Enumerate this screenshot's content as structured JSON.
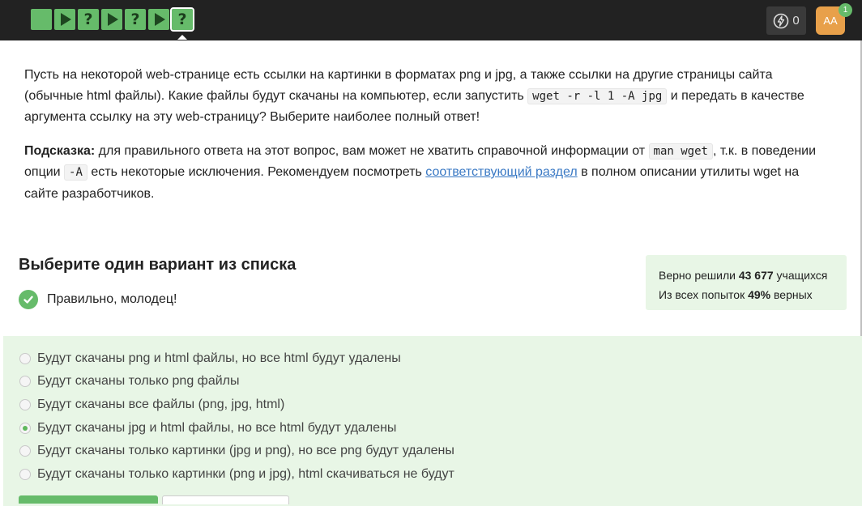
{
  "topbar": {
    "steps": [
      {
        "type": "solved"
      },
      {
        "type": "play"
      },
      {
        "type": "question",
        "label": "?"
      },
      {
        "type": "play"
      },
      {
        "type": "question",
        "label": "?"
      },
      {
        "type": "play"
      },
      {
        "type": "question",
        "label": "?",
        "active": true
      }
    ],
    "energy_count": "0",
    "avatar_initials": "AA",
    "notification_count": "1"
  },
  "question": {
    "p1_a": "Пусть на некоторой web-странице есть ссылки на картинки в форматах png и jpg, а также ссылки на другие страницы сайта (обычные html файлы). Какие файлы будут скачаны на компьютер, если запустить ",
    "p1_code": "wget -r -l 1 -A jpg",
    "p1_b": " и передать в качестве аргумента ссылку на эту web-страницу? Выберите наиболее полный ответ!",
    "hint_label": "Подсказка:",
    "hint_a": " для правильного ответа на этот вопрос, вам может не хватить справочной информации от ",
    "hint_code1": "man wget",
    "hint_b": ", т.к. в поведении опции ",
    "hint_code2": "-A",
    "hint_c": " есть некоторые исключения. Рекомендуем посмотреть ",
    "hint_link": "соответствующий раздел",
    "hint_d": " в полном описании утилиты wget на сайте разработчиков."
  },
  "choose_title": "Выберите один вариант из списка",
  "feedback": "Правильно, молодец!",
  "stats": {
    "line1_prefix": "Верно решили ",
    "line1_value": "43 677",
    "line1_suffix": " учащихся",
    "line2_prefix": "Из всех попыток ",
    "line2_value": "49%",
    "line2_suffix": " верных"
  },
  "options": [
    {
      "label": "Будут скачаны png и html файлы, но все html будут удалены",
      "selected": false
    },
    {
      "label": "Будут скачаны только png файлы",
      "selected": false
    },
    {
      "label": "Будут скачаны все файлы (png, jpg, html)",
      "selected": false
    },
    {
      "label": "Будут скачаны jpg и html файлы, но все html будут удалены",
      "selected": true
    },
    {
      "label": "Будут скачаны только картинки (jpg и png), но все png будут удалены",
      "selected": false
    },
    {
      "label": "Будут скачаны только картинки (png и jpg), html скачиваться не будут",
      "selected": false
    }
  ],
  "colors": {
    "topbar": "#222222",
    "accent_green": "#66bb6a",
    "light_green_bg": "#e8f6e6",
    "link": "#3a79c4",
    "avatar": "#e8a04a"
  }
}
